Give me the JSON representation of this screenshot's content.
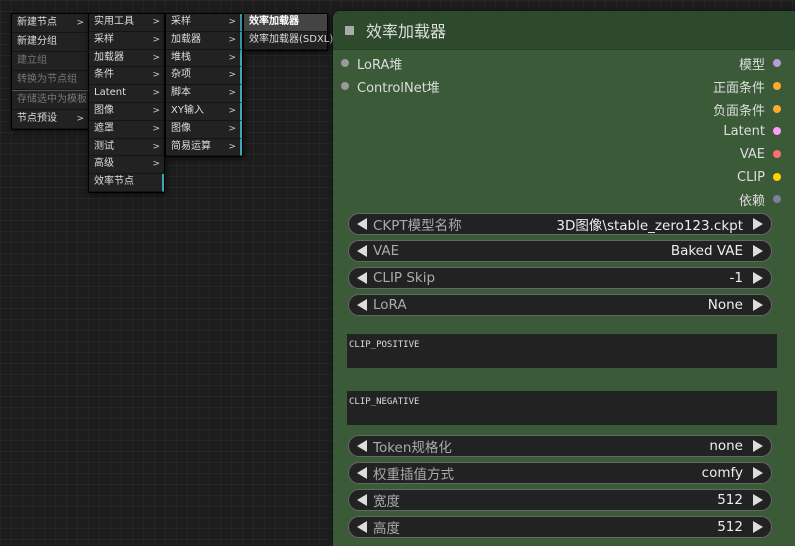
{
  "menus": {
    "root": [
      {
        "label": "新建节点",
        "sub": true
      },
      {
        "label": "新建分组"
      },
      {
        "label": "建立组",
        "disabled": true
      },
      {
        "label": "转换为节点组",
        "disabled": true
      },
      {
        "label": "存储选中为模板",
        "disabled": true
      },
      {
        "label": "节点预设",
        "sub": true
      }
    ],
    "categories": [
      "实用工具",
      "采样",
      "加载器",
      "条件",
      "Latent",
      "图像",
      "遮罩",
      "测试",
      "高级",
      "效率节点"
    ],
    "efficiency": [
      "采样",
      "加载器",
      "堆栈",
      "杂项",
      "脚本",
      "XY输入",
      "图像",
      "简易运算"
    ],
    "loaders": [
      "效率加载器",
      "效率加载器(SDXL)"
    ],
    "arrow": ">"
  },
  "node": {
    "title": "效率加载器",
    "inputs": [
      "LoRA堆",
      "ControlNet堆"
    ],
    "outputs": [
      {
        "label": "模型",
        "color": "#b39ddb"
      },
      {
        "label": "正面条件",
        "color": "#ffa931"
      },
      {
        "label": "负面条件",
        "color": "#ffa931"
      },
      {
        "label": "Latent",
        "color": "#ff9cf9"
      },
      {
        "label": "VAE",
        "color": "#ff6e6e"
      },
      {
        "label": "CLIP",
        "color": "#ffd500"
      },
      {
        "label": "依赖",
        "color": "#7f7f9f"
      }
    ],
    "widgets_top": [
      {
        "label": "CKPT模型名称",
        "value": "3D图像\\stable_zero123.ckpt"
      },
      {
        "label": "VAE",
        "value": "Baked VAE"
      },
      {
        "label": "CLIP Skip",
        "value": "-1"
      },
      {
        "label": "LoRA",
        "value": "None"
      }
    ],
    "clip_positive": "CLIP_POSITIVE",
    "clip_negative": "CLIP_NEGATIVE",
    "widgets_bottom": [
      {
        "label": "Token规格化",
        "value": "none"
      },
      {
        "label": "权重插值方式",
        "value": "comfy"
      },
      {
        "label": "宽度",
        "value": "512"
      },
      {
        "label": "高度",
        "value": "512"
      }
    ]
  }
}
